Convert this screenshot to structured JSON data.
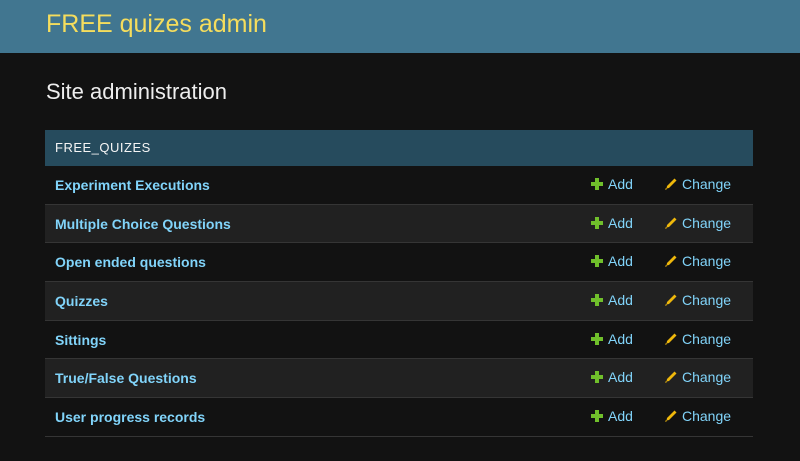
{
  "header": {
    "brand": "FREE quizes admin"
  },
  "page": {
    "title": "Site administration"
  },
  "module": {
    "caption": "FREE_QUIZES",
    "add_label": "Add",
    "change_label": "Change",
    "rows": [
      {
        "label": "Experiment Executions"
      },
      {
        "label": "Multiple Choice Questions"
      },
      {
        "label": "Open ended questions"
      },
      {
        "label": "Quizzes"
      },
      {
        "label": "Sittings"
      },
      {
        "label": "True/False Questions"
      },
      {
        "label": "User progress records"
      }
    ]
  },
  "colors": {
    "header_bg": "#417690",
    "brand_text": "#f5dd5d",
    "caption_bg": "#264b5d",
    "link": "#81d4fa",
    "add_icon": "#70bf2b",
    "change_icon": "#efb80b"
  },
  "icons": {
    "add": "plus-icon",
    "change": "pencil-icon"
  }
}
